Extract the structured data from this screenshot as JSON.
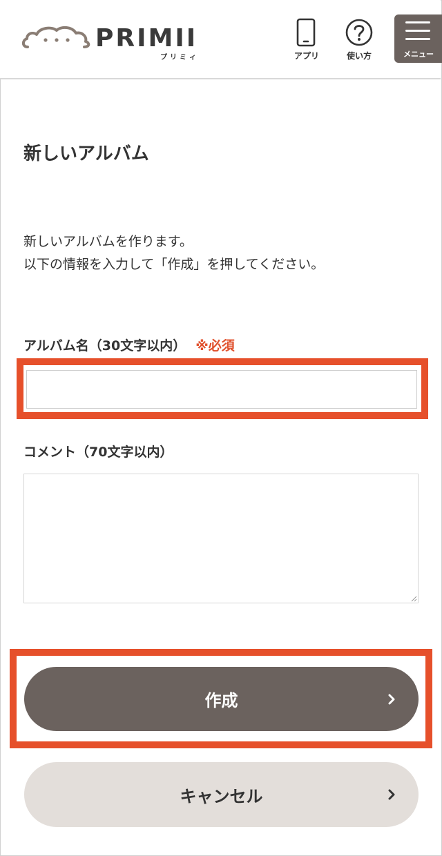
{
  "header": {
    "logo_text": "PRIMII",
    "logo_kana": "プリミィ",
    "app_label": "アプリ",
    "help_label": "使い方",
    "menu_label": "メニュー"
  },
  "page": {
    "title": "新しいアルバム",
    "intro_line1": "新しいアルバムを作ります。",
    "intro_line2": "以下の情報を入力して「作成」を押してください。"
  },
  "form": {
    "album_name_label": "アルバム名（30文字以内）",
    "required_mark": "※必須",
    "album_name_value": "",
    "comment_label": "コメント（70文字以内）",
    "comment_value": ""
  },
  "actions": {
    "create_label": "作成",
    "cancel_label": "キャンセル"
  },
  "colors": {
    "accent_brown": "#6b625e",
    "highlight_orange": "#e6502b",
    "required_red": "#e0502c",
    "cancel_bg": "#e3deda"
  }
}
